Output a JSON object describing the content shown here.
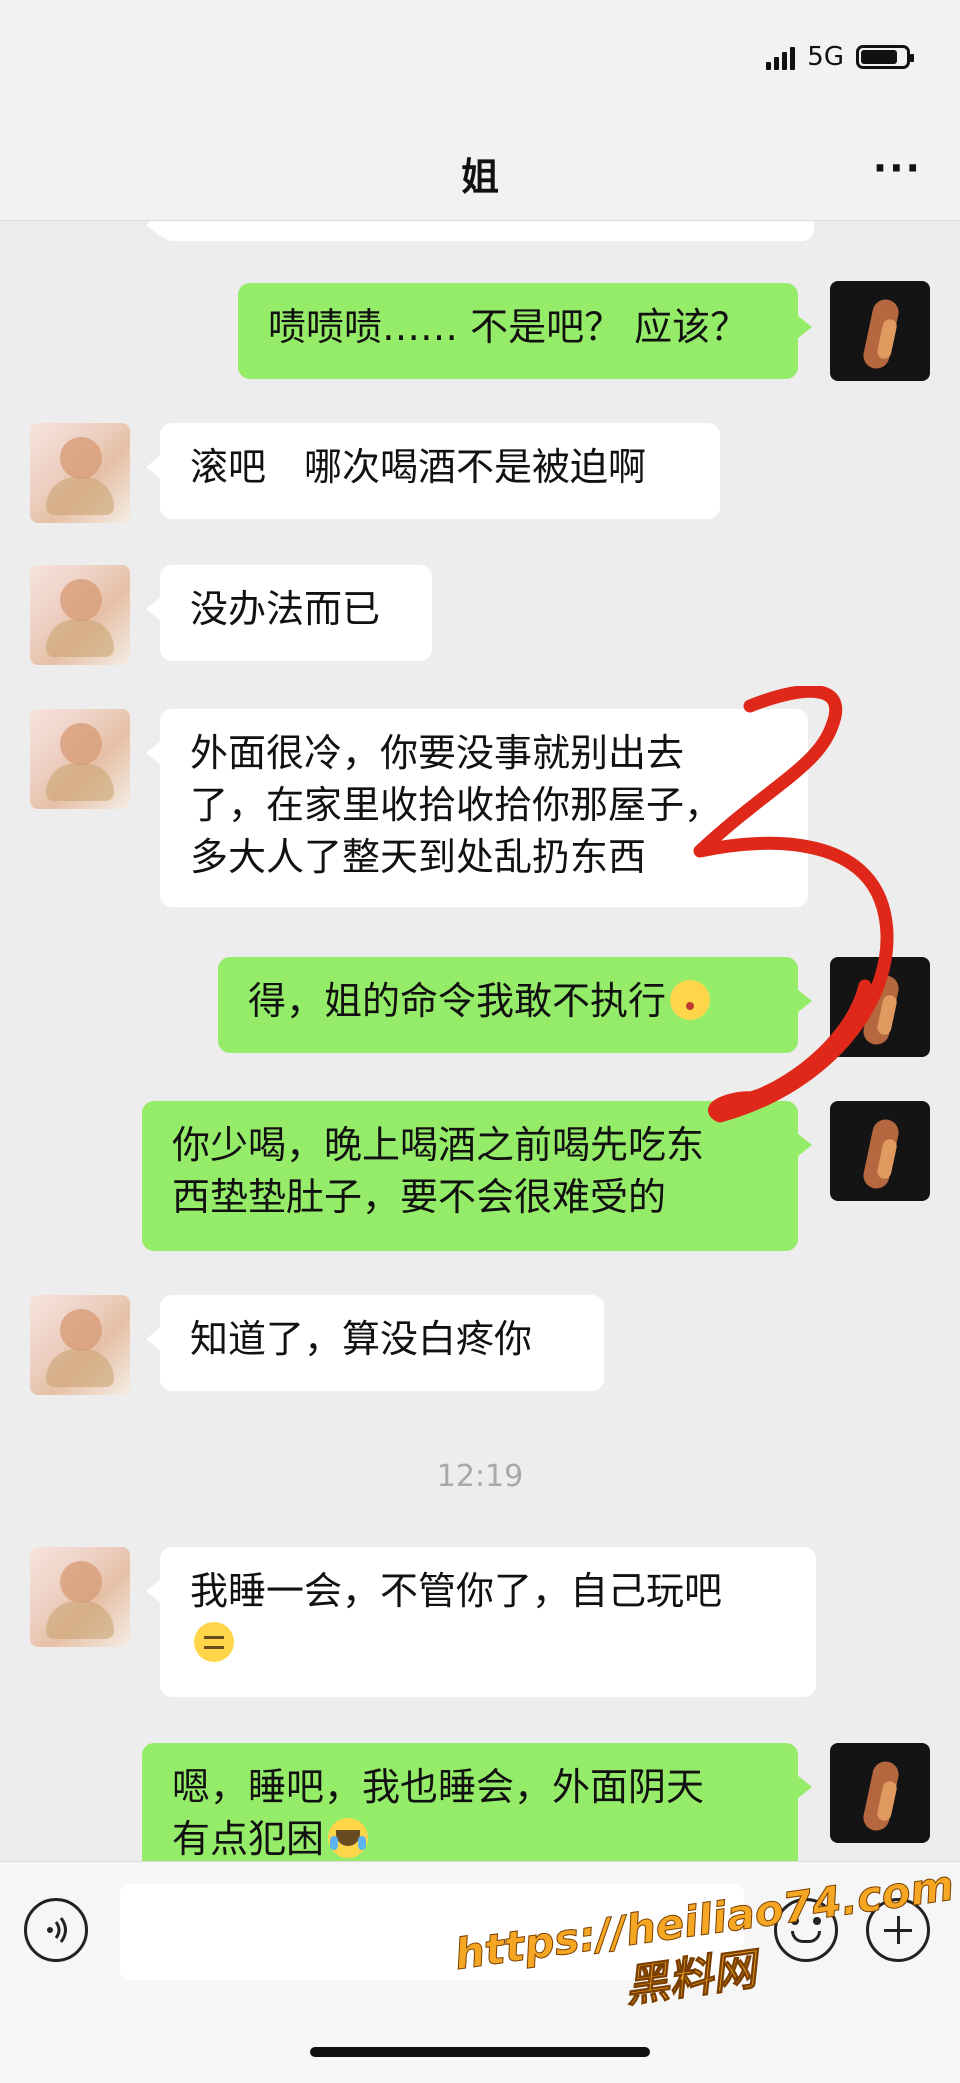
{
  "status_bar": {
    "network": "5G"
  },
  "header": {
    "title": "姐",
    "more_label": "···"
  },
  "messages": [
    {
      "from": "me",
      "text": "啧啧啧…… 不是吧？ 应该？"
    },
    {
      "from": "sister",
      "text": "滚吧　哪次喝酒不是被迫啊"
    },
    {
      "from": "sister",
      "text": "没办法而已"
    },
    {
      "from": "sister",
      "lines": [
        "外面很冷，你要没事就别出去",
        "了，在家里收拾收拾你那屋子，",
        "多大人了整天到处乱扔东西"
      ]
    },
    {
      "from": "me",
      "text": "得，姐的命令我敢不执行",
      "emoji": "kissing-face"
    },
    {
      "from": "me",
      "lines": [
        "你少喝，晚上喝酒之前喝先吃东",
        "西垫垫肚子，要不会很难受的"
      ]
    },
    {
      "from": "sister",
      "text": "知道了，算没白疼你"
    },
    {
      "from": "sister",
      "text": "我睡一会，不管你了，自己玩吧",
      "emoji": "unamused-face"
    },
    {
      "from": "me",
      "lines": [
        "嗯，睡吧，我也睡会，外面阴天",
        "有点犯困"
      ],
      "emoji": "loudly-crying-face"
    }
  ],
  "timestamp": "12:19",
  "input_bar": {
    "placeholder": ""
  },
  "watermark": {
    "url": "https://heiliao74.com",
    "name": "黑料网"
  },
  "colors": {
    "outgoing_bubble": "#95ec69",
    "incoming_bubble": "#ffffff",
    "background": "#ededed",
    "annotation": "#e0281a",
    "watermark": "#f5a623"
  }
}
